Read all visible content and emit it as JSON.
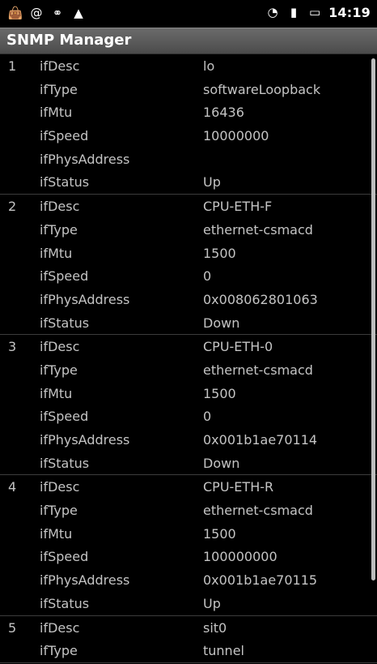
{
  "status_bar": {
    "time": "14:19",
    "icons": [
      "bag-icon",
      "at-icon",
      "usb-icon",
      "warning-icon",
      "wifi-icon",
      "signal-icon",
      "battery-icon"
    ]
  },
  "app": {
    "title": "SNMP Manager"
  },
  "interfaces": [
    {
      "index": "1",
      "rows": [
        {
          "key": "ifDesc",
          "value": "lo"
        },
        {
          "key": "ifType",
          "value": "softwareLoopback"
        },
        {
          "key": "ifMtu",
          "value": "16436"
        },
        {
          "key": "ifSpeed",
          "value": "10000000"
        },
        {
          "key": "ifPhysAddress",
          "value": ""
        },
        {
          "key": "ifStatus",
          "value": "Up"
        }
      ]
    },
    {
      "index": "2",
      "rows": [
        {
          "key": "ifDesc",
          "value": "CPU-ETH-F"
        },
        {
          "key": "ifType",
          "value": "ethernet-csmacd"
        },
        {
          "key": "ifMtu",
          "value": "1500"
        },
        {
          "key": "ifSpeed",
          "value": "0"
        },
        {
          "key": "ifPhysAddress",
          "value": "0x008062801063"
        },
        {
          "key": "ifStatus",
          "value": "Down"
        }
      ]
    },
    {
      "index": "3",
      "rows": [
        {
          "key": "ifDesc",
          "value": "CPU-ETH-0"
        },
        {
          "key": "ifType",
          "value": "ethernet-csmacd"
        },
        {
          "key": "ifMtu",
          "value": "1500"
        },
        {
          "key": "ifSpeed",
          "value": "0"
        },
        {
          "key": "ifPhysAddress",
          "value": "0x001b1ae70114"
        },
        {
          "key": "ifStatus",
          "value": "Down"
        }
      ]
    },
    {
      "index": "4",
      "rows": [
        {
          "key": "ifDesc",
          "value": "CPU-ETH-R"
        },
        {
          "key": "ifType",
          "value": "ethernet-csmacd"
        },
        {
          "key": "ifMtu",
          "value": "1500"
        },
        {
          "key": "ifSpeed",
          "value": "100000000"
        },
        {
          "key": "ifPhysAddress",
          "value": "0x001b1ae70115"
        },
        {
          "key": "ifStatus",
          "value": "Up"
        }
      ]
    },
    {
      "index": "5",
      "rows": [
        {
          "key": "ifDesc",
          "value": "sit0"
        },
        {
          "key": "ifType",
          "value": "tunnel"
        }
      ]
    }
  ]
}
